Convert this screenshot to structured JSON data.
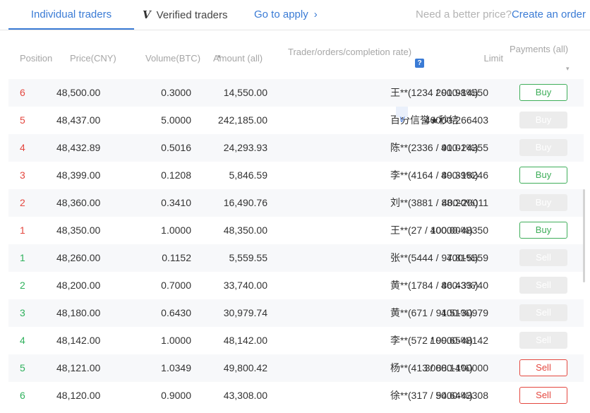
{
  "tabs": {
    "individual": "Individual traders",
    "verified_mark": "V",
    "verified": "Verified traders",
    "apply": "Go to apply",
    "apply_chevron": "›"
  },
  "better_price": {
    "question": "Need a better price?",
    "link": "Create an order"
  },
  "headers": {
    "position": "Position",
    "price": "Price(CNY)",
    "volume": "Volume(BTC)",
    "amount": "Amount (all)",
    "amount_caret": "▾",
    "trader": "Trader/orders/completion rate)",
    "help": "?",
    "limit": "Limit",
    "payments": "Payments (all)",
    "payments_caret": "▾"
  },
  "rows": [
    {
      "side": "buy",
      "position": "6",
      "price": "48,500.00",
      "volume": "0.3000",
      "amount": "14,550.00",
      "trader": "王**(1234 / 91.98%)",
      "verified": false,
      "limit": "2000-14550",
      "action": "Buy",
      "enabled": true
    },
    {
      "side": "buy",
      "position": "5",
      "price": "48,437.00",
      "volume": "5.0000",
      "amount": "242,185.00",
      "trader": "百分信誉★秒结",
      "verified": true,
      "limit": "40000-266403",
      "action": "Buy",
      "enabled": false
    },
    {
      "side": "buy",
      "position": "4",
      "price": "48,432.89",
      "volume": "0.5016",
      "amount": "24,293.93",
      "trader": "陈**(2336 / 91.01%)",
      "verified": false,
      "limit": "400-24355",
      "action": "Buy",
      "enabled": false
    },
    {
      "side": "buy",
      "position": "3",
      "price": "48,399.00",
      "volume": "0.1208",
      "amount": "5,846.59",
      "trader": "李**(4164 / 89.39%)",
      "verified": false,
      "limit": "400-18246",
      "action": "Buy",
      "enabled": true
    },
    {
      "side": "buy",
      "position": "2",
      "price": "48,360.00",
      "volume": "0.3410",
      "amount": "16,490.76",
      "trader": "刘**(3881 / 88.20%)",
      "verified": false,
      "limit": "400-20011",
      "action": "Buy",
      "enabled": false
    },
    {
      "side": "buy",
      "position": "1",
      "price": "48,350.00",
      "volume": "1.0000",
      "amount": "48,350.00",
      "trader": "王**(27 / 100.00%)",
      "verified": false,
      "limit": "40000-48350",
      "action": "Buy",
      "enabled": true
    },
    {
      "side": "sell",
      "position": "1",
      "price": "48,260.00",
      "volume": "0.1152",
      "amount": "5,559.55",
      "trader": "张**(5444 / 97.81%)",
      "verified": false,
      "limit": "400-5559",
      "action": "Sell",
      "enabled": false
    },
    {
      "side": "sell",
      "position": "2",
      "price": "48,200.00",
      "volume": "0.7000",
      "amount": "33,740.00",
      "trader": "黄**(1784 / 86.43%)",
      "verified": false,
      "limit": "400-33740",
      "action": "Sell",
      "enabled": false
    },
    {
      "side": "sell",
      "position": "3",
      "price": "48,180.00",
      "volume": "0.6430",
      "amount": "30,979.74",
      "trader": "黄**(671 / 91.51%)",
      "verified": false,
      "limit": "400-30979",
      "action": "Sell",
      "enabled": false
    },
    {
      "side": "sell",
      "position": "4",
      "price": "48,142.00",
      "volume": "1.0000",
      "amount": "48,142.00",
      "trader": "李**(572 / 99.65%)",
      "verified": false,
      "limit": "10000-48142",
      "action": "Sell",
      "enabled": false
    },
    {
      "side": "sell",
      "position": "5",
      "price": "48,121.00",
      "volume": "1.0349",
      "amount": "49,800.42",
      "trader": "杨**(413 / 88.14%)",
      "verified": false,
      "limit": "30000-100000",
      "action": "Sell",
      "enabled": true
    },
    {
      "side": "sell",
      "position": "6",
      "price": "48,120.00",
      "volume": "0.9000",
      "amount": "43,308.00",
      "trader": "徐**(317 / 94.64%)",
      "verified": false,
      "limit": "5000-43308",
      "action": "Sell",
      "enabled": true
    }
  ],
  "verified_badge": "V",
  "colors": {
    "accent": "#3a7bd5",
    "buy": "#e4473f",
    "sell": "#2fb15c",
    "buy_button": "#3fae5a",
    "sell_button": "#e4473f"
  }
}
